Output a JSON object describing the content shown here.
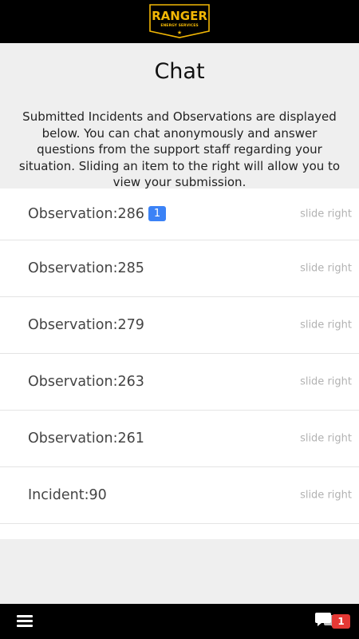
{
  "header": {
    "logo_text": "RANGER",
    "logo_subtext": "ENERGY SERVICES"
  },
  "page": {
    "title": "Chat",
    "intro": "Submitted Incidents and Observations are displayed below. You can chat anonymously and answer questions from the support staff regarding your situation. Sliding an item to the right will allow you to view your submission."
  },
  "items": [
    {
      "label": "Observation:286",
      "badge": "1",
      "hint": "slide right"
    },
    {
      "label": "Observation:285",
      "hint": "slide right"
    },
    {
      "label": "Observation:279",
      "hint": "slide right"
    },
    {
      "label": "Observation:263",
      "hint": "slide right"
    },
    {
      "label": "Observation:261",
      "hint": "slide right"
    },
    {
      "label": "Incident:90",
      "hint": "slide right"
    }
  ],
  "footer": {
    "menu_icon": "hamburger-menu-icon",
    "chat_icon": "chat-bubbles-icon",
    "chat_badge": "1"
  },
  "colors": {
    "bar": "#000000",
    "brand_gold": "#f2b705",
    "badge_blue": "#3b82f6",
    "badge_red": "#e53935"
  }
}
